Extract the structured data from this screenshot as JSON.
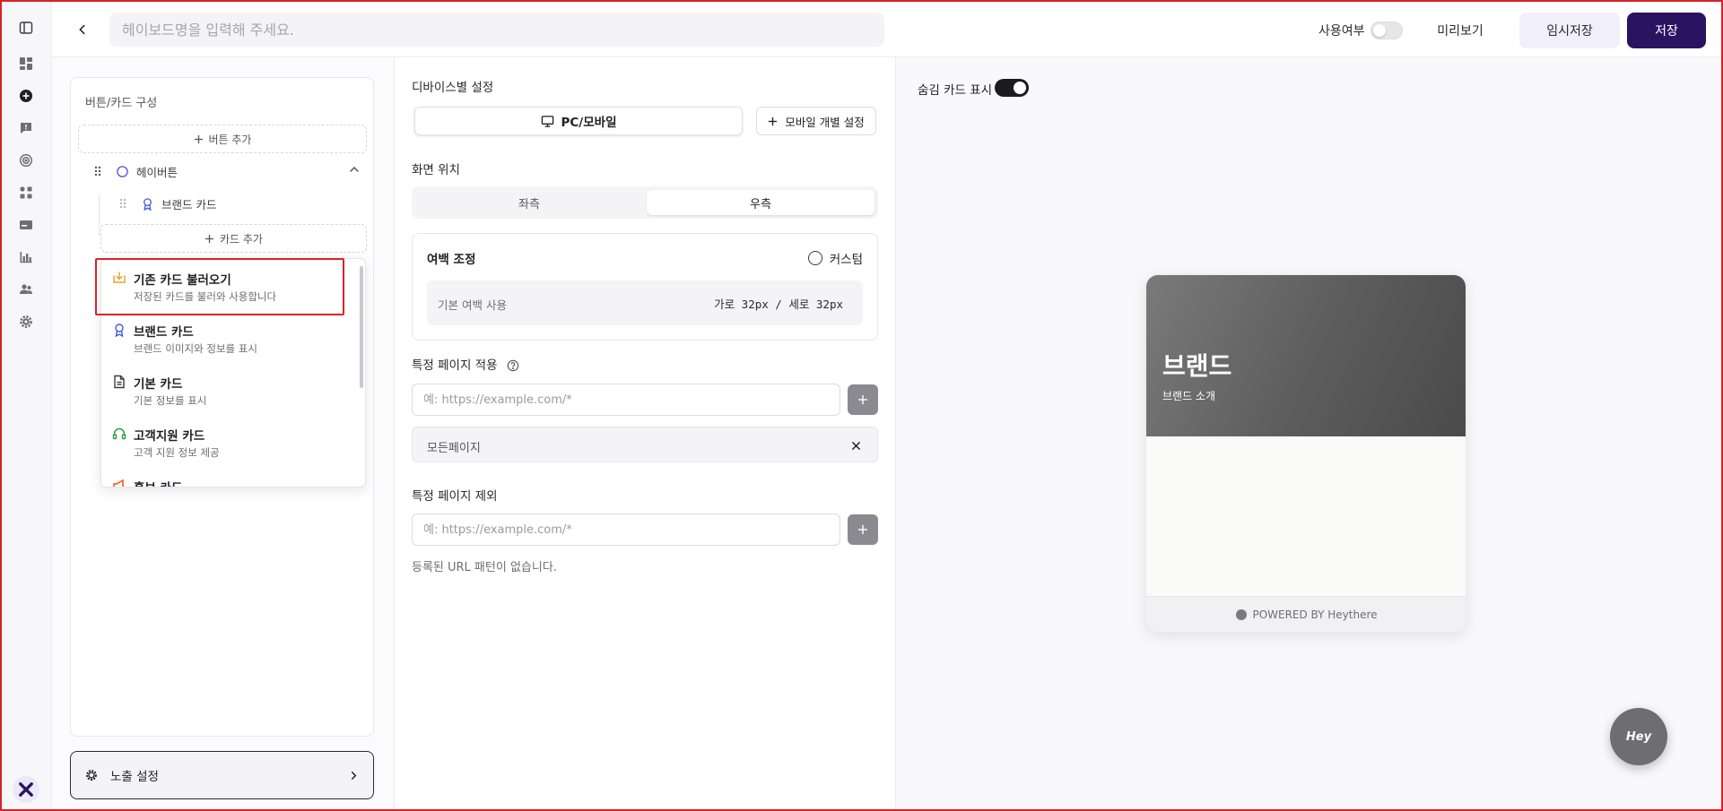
{
  "header": {
    "title_placeholder": "헤이보드명을 입력해 주세요.",
    "use_label": "사용여부",
    "use_enabled": false,
    "preview_label": "미리보기",
    "draft_label": "임시저장",
    "save_label": "저장"
  },
  "rail": {
    "icons": [
      "sidebar-toggle-icon",
      "dashboard-icon",
      "add-circle-icon",
      "chat-icon",
      "target-icon",
      "apps-icon",
      "card-icon",
      "bar-chart-icon",
      "users-icon",
      "gear-icon"
    ],
    "logo": "x-logo-icon"
  },
  "config": {
    "panel_title": "버튼/카드 구성",
    "add_button_label": "버튼 추가",
    "heybutton_label": "헤이버튼",
    "brand_card_label": "브랜드 카드",
    "add_card_label": "카드 추가",
    "dropdown_items": [
      {
        "title": "기존 카드 불러오기",
        "desc": "저장된 카드를 불러와 사용합니다",
        "icon": "import-icon",
        "color": "#e0a32a"
      },
      {
        "title": "브랜드 카드",
        "desc": "브랜드 이미지와 정보를 표시",
        "icon": "award-icon",
        "color": "#3b5bdb"
      },
      {
        "title": "기본 카드",
        "desc": "기본 정보를 표시",
        "icon": "document-icon",
        "color": "#3a3a42"
      },
      {
        "title": "고객지원 카드",
        "desc": "고객 지원 정보 제공",
        "icon": "headset-icon",
        "color": "#2f9e44"
      },
      {
        "title": "홍보 카드",
        "desc": "",
        "icon": "megaphone-icon",
        "color": "#e8590c"
      }
    ],
    "expose_label": "노출 설정"
  },
  "device": {
    "section_label": "디바이스별 설정",
    "pc_label": "PC/모바일",
    "mobile_label": "모바일 개별 설정"
  },
  "position": {
    "section_label": "화면 위치",
    "left_label": "좌측",
    "right_label": "우측",
    "selected": "right"
  },
  "margin": {
    "title": "여백 조정",
    "custom_label": "커스텀",
    "default_label": "기본 여백 사용",
    "value_text": "가로 32px / 세로 32px"
  },
  "include_pages": {
    "section_label": "특정 페이지 적용",
    "placeholder": "예: https://example.com/*",
    "tags": [
      "모든페이지"
    ]
  },
  "exclude_pages": {
    "section_label": "특정 페이지 제외",
    "placeholder": "예: https://example.com/*",
    "empty_message": "등록된 URL 패턴이 없습니다."
  },
  "preview": {
    "hidden_card_label": "숨김 카드 표시",
    "hidden_card_enabled": true,
    "card_title": "브랜드",
    "card_subtitle": "브랜드 소개",
    "footer_text": "POWERED BY Heythere",
    "fab_label": "Hey"
  }
}
